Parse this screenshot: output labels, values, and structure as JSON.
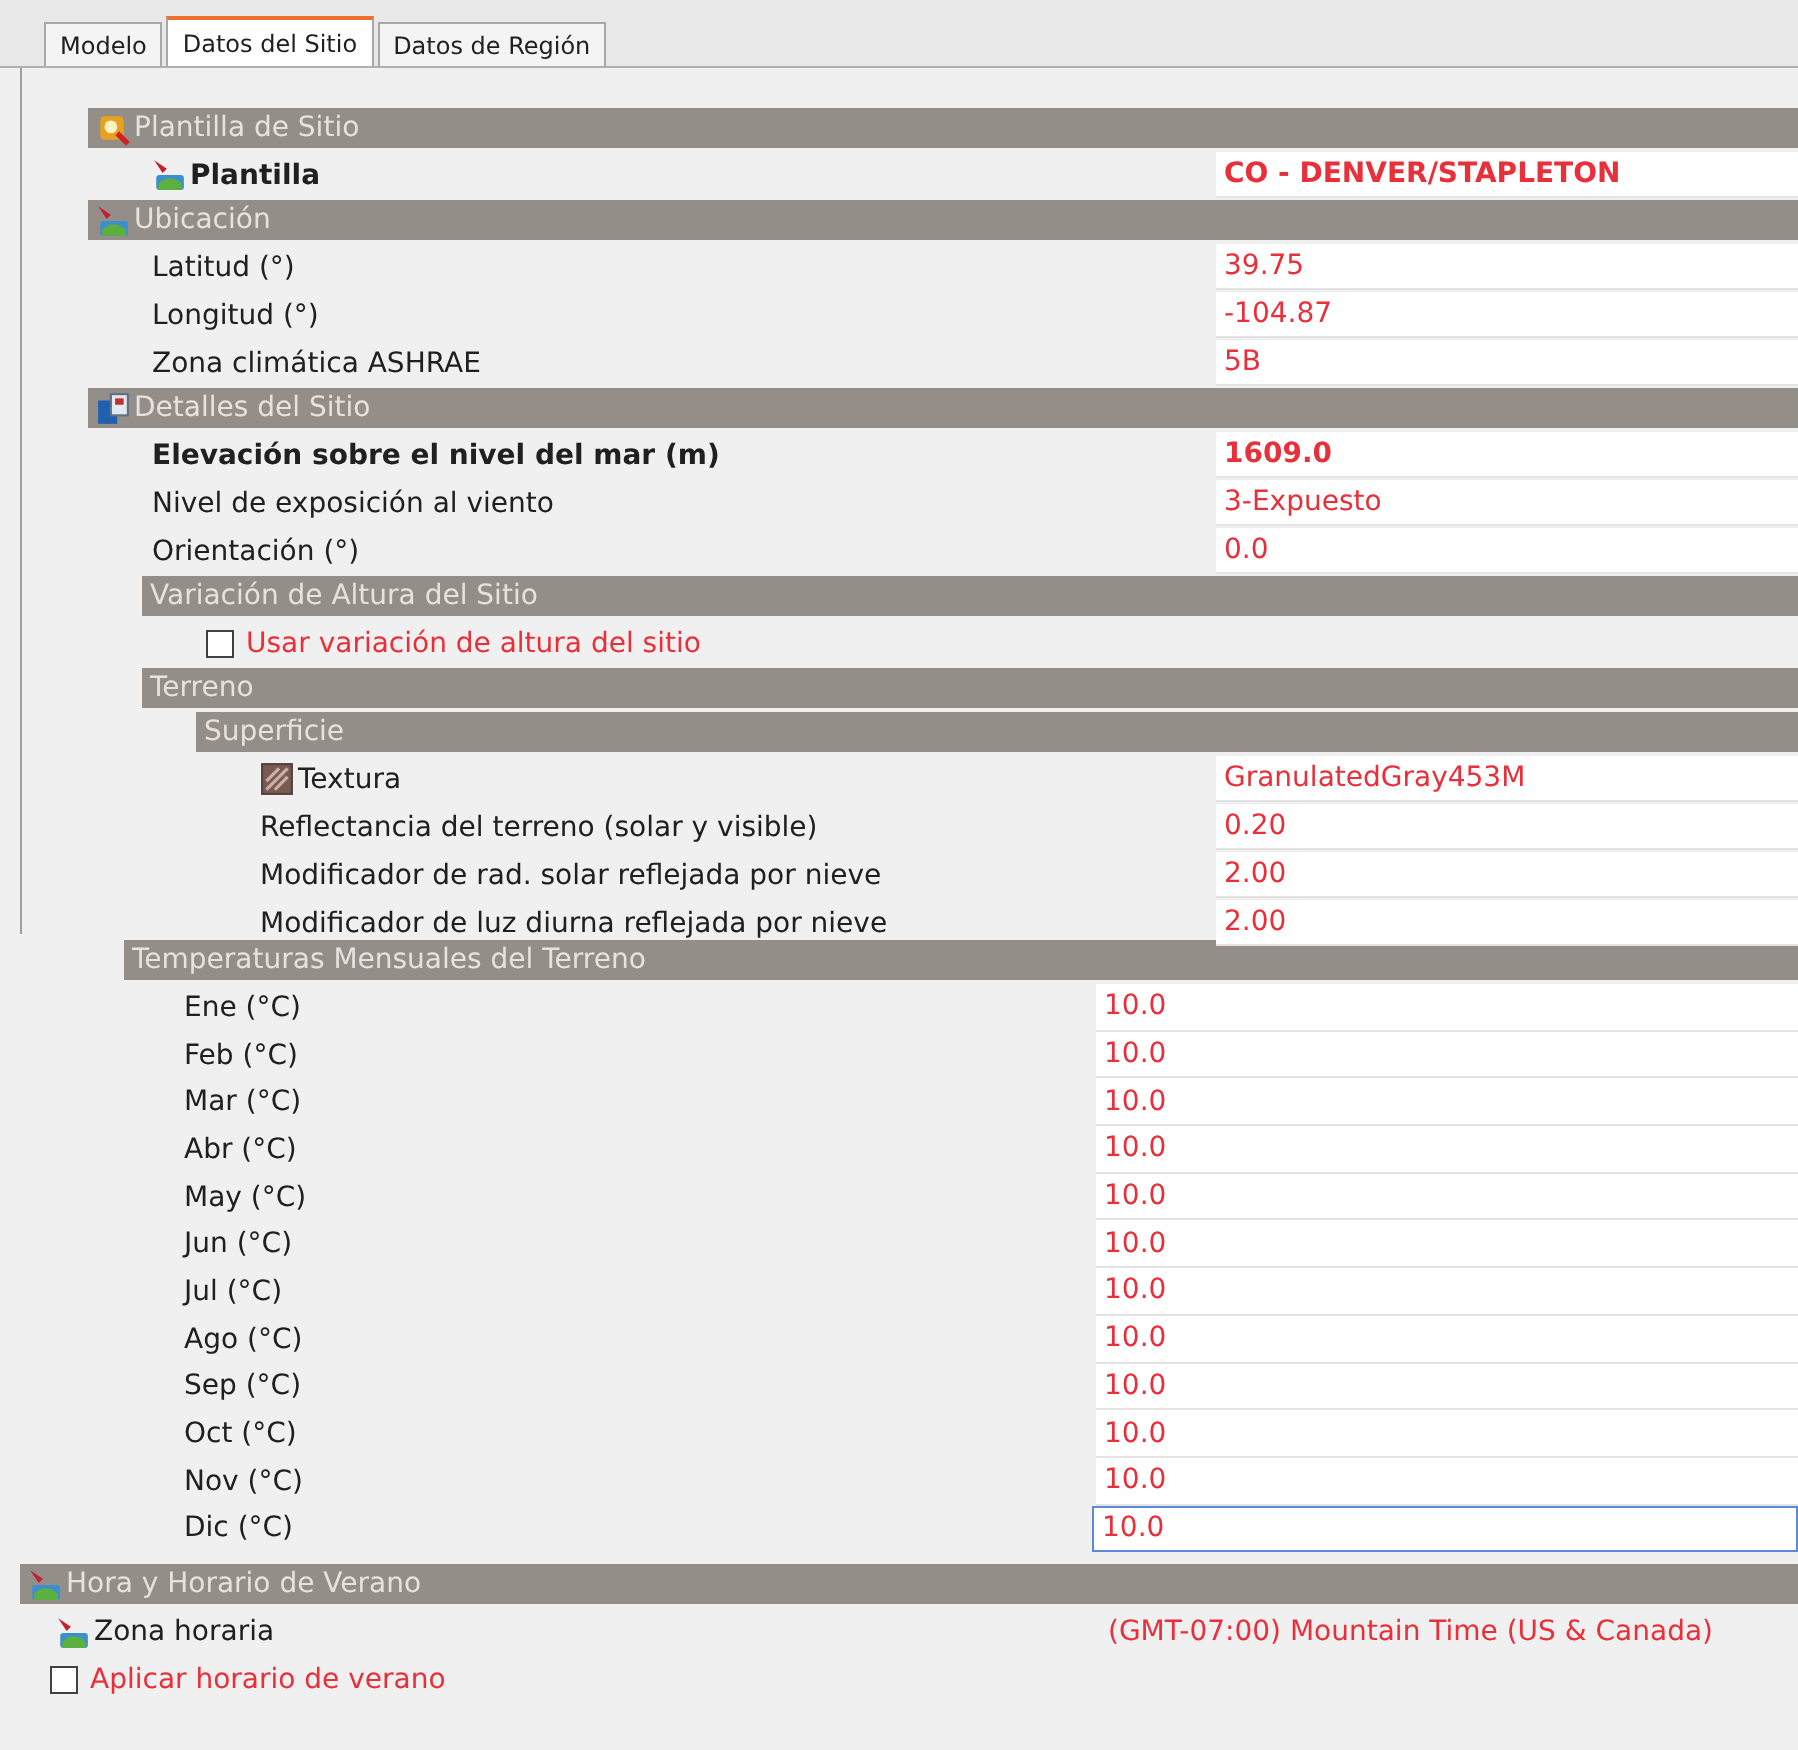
{
  "tabs": [
    {
      "label": "Modelo",
      "selected": false
    },
    {
      "label": "Datos del Sitio",
      "selected": true
    },
    {
      "label": "Datos de Región",
      "selected": false
    }
  ],
  "sections": [
    {
      "title": "Plantilla de Sitio",
      "rows": [
        {
          "kind": "property",
          "label": "Plantilla",
          "value": "CO - DENVER/STAPLETON",
          "bold": true
        }
      ]
    },
    {
      "title": "Ubicación",
      "rows": [
        {
          "kind": "property",
          "label": "Latitud (°)",
          "value": "39.75",
          "bold": false
        },
        {
          "kind": "property",
          "label": "Longitud (°)",
          "value": "-104.87",
          "bold": false
        },
        {
          "kind": "property",
          "label": "Zona climática ASHRAE",
          "value": "5B",
          "bold": false
        }
      ]
    },
    {
      "title": "Detalles del Sitio",
      "rows": [
        {
          "kind": "property",
          "label": "Elevación sobre el nivel del mar (m)",
          "value": "1609.0",
          "bold": true
        },
        {
          "kind": "property",
          "label": "Nivel de exposición al viento",
          "value": "3-Expuesto",
          "bold": false
        },
        {
          "kind": "property",
          "label": "Orientación (°)",
          "value": "0.0",
          "bold": false
        }
      ],
      "children": [
        {
          "title": "Variación de Altura del Sitio",
          "rows": [
            {
              "kind": "checkbox",
              "label": "Usar variación de altura del sitio",
              "checked": false
            }
          ]
        },
        {
          "title": "Terreno",
          "children": [
            {
              "title": "Superficie",
              "rows": [
                {
                  "kind": "property",
                  "label": "Textura",
                  "value": "GranulatedGray453M",
                  "bold": false
                },
                {
                  "kind": "property",
                  "label": "Reflectancia del terreno (solar y visible)",
                  "value": "0.20",
                  "bold": false
                },
                {
                  "kind": "property",
                  "label": "Modificador de rad. solar reflejada por nieve",
                  "value": "2.00",
                  "bold": false
                },
                {
                  "kind": "property",
                  "label": "Modificador de luz diurna reflejada por nieve",
                  "value": "2.00",
                  "bold": false
                }
              ]
            }
          ]
        }
      ]
    }
  ],
  "monthly": {
    "title": "Temperaturas Mensuales del Terreno",
    "rows": [
      {
        "label": "Ene (°C)",
        "value": "10.0",
        "selected": false
      },
      {
        "label": "Feb (°C)",
        "value": "10.0",
        "selected": false
      },
      {
        "label": "Mar (°C)",
        "value": "10.0",
        "selected": false
      },
      {
        "label": "Abr (°C)",
        "value": "10.0",
        "selected": false
      },
      {
        "label": "May (°C)",
        "value": "10.0",
        "selected": false
      },
      {
        "label": "Jun (°C)",
        "value": "10.0",
        "selected": false
      },
      {
        "label": "Jul (°C)",
        "value": "10.0",
        "selected": false
      },
      {
        "label": "Ago (°C)",
        "value": "10.0",
        "selected": false
      },
      {
        "label": "Sep (°C)",
        "value": "10.0",
        "selected": false
      },
      {
        "label": "Oct (°C)",
        "value": "10.0",
        "selected": false
      },
      {
        "label": "Nov (°C)",
        "value": "10.0",
        "selected": false
      },
      {
        "label": "Dic (°C)",
        "value": "10.0",
        "selected": true
      }
    ]
  },
  "time": {
    "title": "Hora y Horario de Verano",
    "rows": [
      {
        "kind": "property",
        "label": "Zona horaria",
        "value": "(GMT-07:00) Mountain Time (US & Canada)",
        "bold": false
      },
      {
        "kind": "checkbox",
        "label": "Aplicar horario de verano",
        "checked": false
      }
    ]
  }
}
